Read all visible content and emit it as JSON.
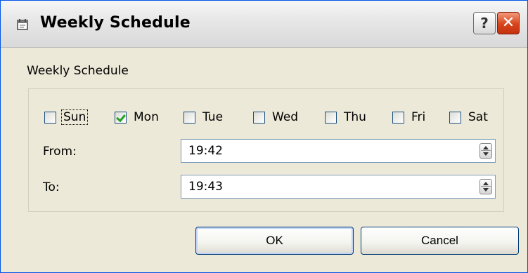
{
  "window": {
    "title": "Weekly Schedule",
    "help_label": "?",
    "close_label": "✕"
  },
  "form": {
    "label": "Weekly Schedule",
    "days": [
      {
        "label": "Sun",
        "checked": false
      },
      {
        "label": "Mon",
        "checked": true
      },
      {
        "label": "Tue",
        "checked": false
      },
      {
        "label": "Wed",
        "checked": false
      },
      {
        "label": "Thu",
        "checked": false
      },
      {
        "label": "Fri",
        "checked": false
      },
      {
        "label": "Sat",
        "checked": false
      }
    ],
    "from_label": "From:",
    "from_value": "19:42",
    "to_label": "To:",
    "to_value": "19:43"
  },
  "buttons": {
    "ok_label": "OK",
    "cancel_label": "Cancel"
  }
}
